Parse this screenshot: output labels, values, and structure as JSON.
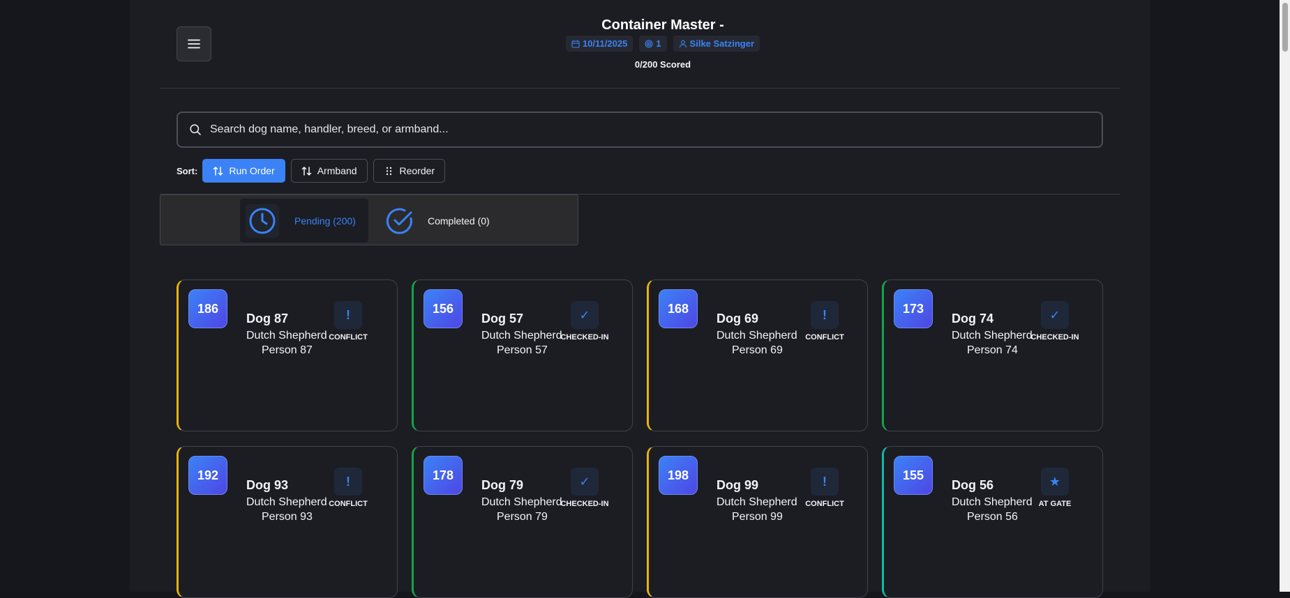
{
  "header": {
    "title": "Container Master -",
    "date": "10/11/2025",
    "entry_count": "1",
    "judge": "Silke Satzinger",
    "scored": "0/200 Scored"
  },
  "search": {
    "placeholder": "Search dog name, handler, breed, or armband..."
  },
  "sort": {
    "label": "Sort:",
    "buttons": [
      {
        "label": "Run Order",
        "active": true
      },
      {
        "label": "Armband",
        "active": false
      },
      {
        "label": "Reorder",
        "active": false
      }
    ]
  },
  "tabs": {
    "pending": "Pending (200)",
    "completed": "Completed (0)"
  },
  "colors": {
    "accent": "#3b82f6",
    "conflict": "#eab308",
    "checked_in": "#16a34a",
    "at_gate": "#14b8a6"
  },
  "cards": [
    {
      "armband": "186",
      "name": "Dog 87",
      "breed": "Dutch Shepherd",
      "handler": "Person 87",
      "status": "CONFLICT",
      "status_icon": "!",
      "kind": "conflict"
    },
    {
      "armband": "156",
      "name": "Dog 57",
      "breed": "Dutch Shepherd",
      "handler": "Person 57",
      "status": "CHECKED-IN",
      "status_icon": "✓",
      "kind": "checked"
    },
    {
      "armband": "168",
      "name": "Dog 69",
      "breed": "Dutch Shepherd",
      "handler": "Person 69",
      "status": "CONFLICT",
      "status_icon": "!",
      "kind": "conflict"
    },
    {
      "armband": "173",
      "name": "Dog 74",
      "breed": "Dutch Shepherd",
      "handler": "Person 74",
      "status": "CHECKED-IN",
      "status_icon": "✓",
      "kind": "checked"
    },
    {
      "armband": "192",
      "name": "Dog 93",
      "breed": "Dutch Shepherd",
      "handler": "Person 93",
      "status": "CONFLICT",
      "status_icon": "!",
      "kind": "conflict"
    },
    {
      "armband": "178",
      "name": "Dog 79",
      "breed": "Dutch Shepherd",
      "handler": "Person 79",
      "status": "CHECKED-IN",
      "status_icon": "✓",
      "kind": "checked"
    },
    {
      "armband": "198",
      "name": "Dog 99",
      "breed": "Dutch Shepherd",
      "handler": "Person 99",
      "status": "CONFLICT",
      "status_icon": "!",
      "kind": "conflict"
    },
    {
      "armband": "155",
      "name": "Dog 56",
      "breed": "Dutch Shepherd",
      "handler": "Person 56",
      "status": "AT GATE",
      "status_icon": "★",
      "kind": "gate"
    }
  ]
}
